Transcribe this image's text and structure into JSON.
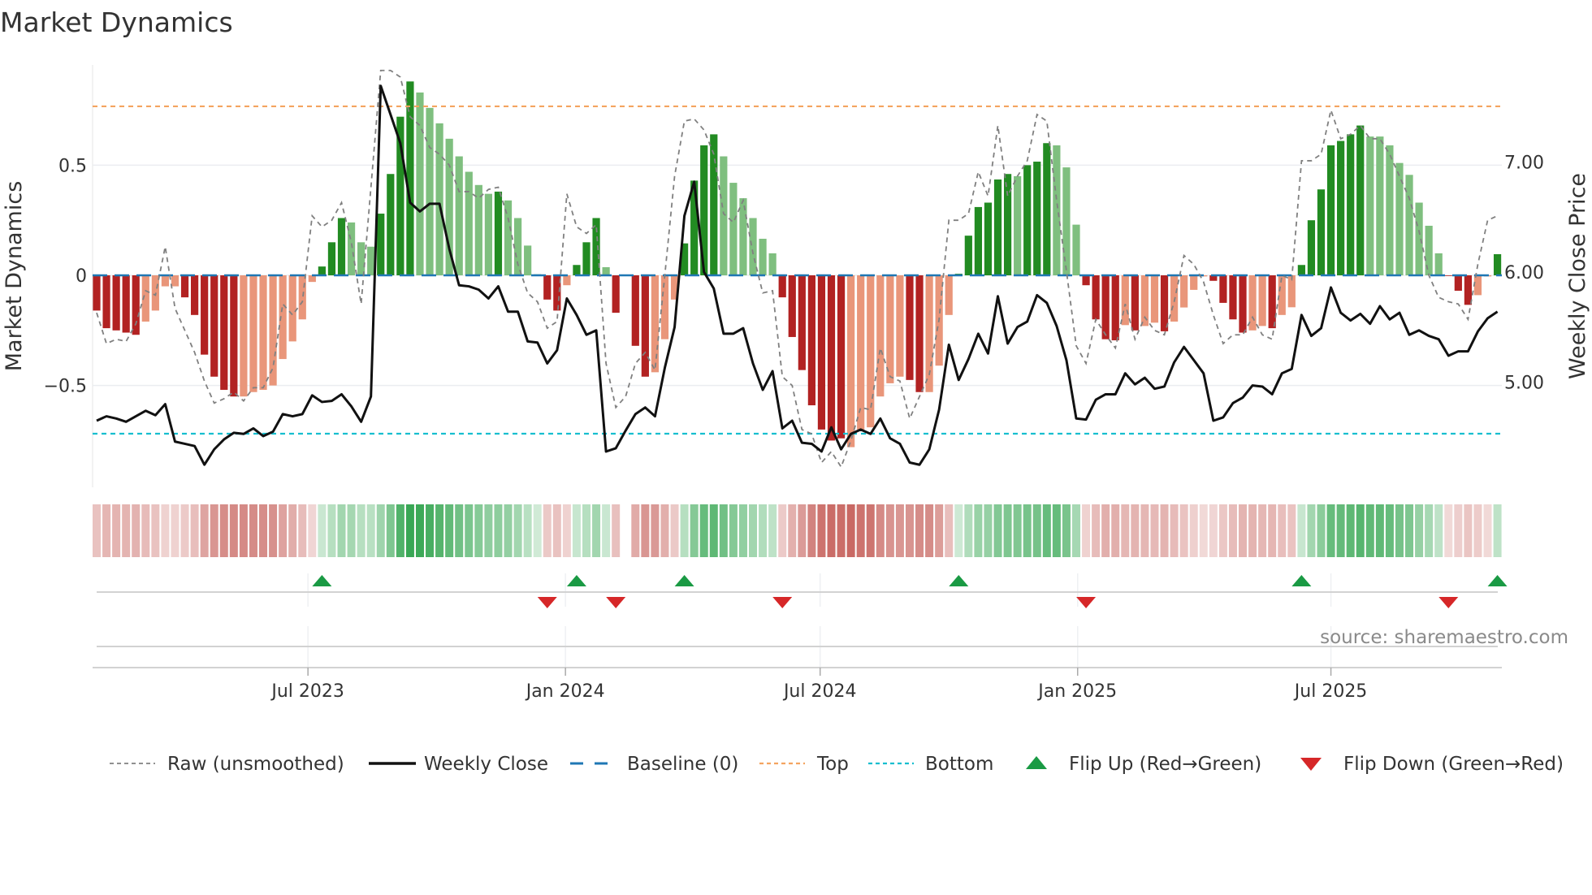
{
  "chart_data": {
    "type": "bar",
    "title": "Market Dynamics",
    "ylabel": "Market Dynamics",
    "y2label": "Weekly Close Price",
    "source": "source: sharemaestro.com",
    "start_date": "2023-01-31",
    "interval_days": 7,
    "ylim": [
      -0.97,
      0.95
    ],
    "y_ticks": [
      {
        "value": 0.5,
        "label": "0.5"
      },
      {
        "value": 0,
        "label": "0"
      },
      {
        "value": -0.5,
        "label": "−0.5"
      }
    ],
    "y2_ticks": [
      {
        "value": 7,
        "label": "7.00"
      },
      {
        "value": 6,
        "label": "6.00"
      },
      {
        "value": 5,
        "label": "5.00"
      }
    ],
    "x_ticks": [
      {
        "date": "2023-07-01",
        "label": "Jul 2023"
      },
      {
        "date": "2024-01-01",
        "label": "Jan 2024"
      },
      {
        "date": "2024-07-01",
        "label": "Jul 2024"
      },
      {
        "date": "2025-01-01",
        "label": "Jan 2025"
      },
      {
        "date": "2025-07-01",
        "label": "Jul 2025"
      }
    ],
    "top_level": 0.767,
    "bottom_level": -0.719,
    "baseline": 0,
    "colors": {
      "strong_up": "#228b22",
      "weak_up": "#7fbf7f",
      "strong_down": "#b22222",
      "weak_down": "#e9967a",
      "raw": "#808080",
      "close": "#111111",
      "baseline": "#1f77b4",
      "top": "#f4a460",
      "bottom": "#17becf",
      "flip_up": "#1a9a44",
      "flip_down": "#d62728",
      "strip_up": "#28a046",
      "strip_down": "#c0504a"
    },
    "dynamics": [
      -0.16,
      -0.24,
      -0.25,
      -0.26,
      -0.27,
      -0.21,
      -0.16,
      -0.05,
      -0.05,
      -0.1,
      -0.18,
      -0.36,
      -0.46,
      -0.52,
      -0.55,
      -0.55,
      -0.53,
      -0.52,
      -0.5,
      -0.38,
      -0.3,
      -0.2,
      -0.03,
      0.04,
      0.15,
      0.26,
      0.24,
      0.15,
      0.13,
      0.28,
      0.46,
      0.72,
      0.88,
      0.83,
      0.76,
      0.69,
      0.62,
      0.54,
      0.47,
      0.41,
      0.37,
      0.38,
      0.34,
      0.26,
      0.135,
      0.005,
      -0.11,
      -0.16,
      -0.045,
      0.047,
      0.15,
      0.26,
      0.037,
      -0.17,
      null,
      -0.32,
      -0.46,
      -0.44,
      -0.29,
      -0.11,
      0.145,
      0.43,
      0.59,
      0.64,
      0.54,
      0.42,
      0.35,
      0.26,
      0.166,
      0.1,
      -0.1,
      -0.28,
      -0.43,
      -0.59,
      -0.7,
      -0.75,
      -0.74,
      -0.78,
      -0.7,
      -0.69,
      -0.55,
      -0.49,
      -0.46,
      -0.475,
      -0.53,
      -0.53,
      -0.41,
      -0.18,
      0.007,
      0.18,
      0.31,
      0.33,
      0.435,
      0.46,
      0.45,
      0.5,
      0.516,
      0.6,
      0.59,
      0.49,
      0.23,
      -0.045,
      -0.2,
      -0.29,
      -0.295,
      -0.226,
      -0.25,
      -0.23,
      -0.215,
      -0.254,
      -0.21,
      -0.146,
      -0.066,
      -0.005,
      -0.025,
      -0.125,
      -0.2,
      -0.26,
      -0.25,
      -0.23,
      -0.24,
      -0.18,
      -0.145,
      0.047,
      0.25,
      0.39,
      0.59,
      0.61,
      0.64,
      0.68,
      0.63,
      0.63,
      0.59,
      0.51,
      0.456,
      0.33,
      0.225,
      0.1,
      -0.003,
      -0.07,
      -0.134,
      -0.09,
      -0.005,
      0.096
    ],
    "shade": "DDDDDLLLLDDDDDDLLLLLLLLDDDLLLDDDDLLLLLLLLDLLLLDDLDDDLD-DDLLLDDDDLLLLLLDDDDDDDLLLLLLDDLLLDDDDDDLDDDLLLDDDDLDLLDLLLLDDDDLLDLLDDDDDDDLLLLLLLLDDDLLD",
    "raw": [
      -0.17,
      -0.31,
      -0.29,
      -0.3,
      -0.22,
      -0.07,
      -0.09,
      0.13,
      -0.15,
      -0.25,
      -0.35,
      -0.48,
      -0.58,
      -0.56,
      -0.53,
      -0.57,
      -0.51,
      -0.51,
      -0.42,
      -0.13,
      -0.18,
      -0.12,
      0.27,
      0.22,
      0.25,
      0.33,
      0.15,
      -0.13,
      0.4,
      0.93,
      0.93,
      0.9,
      0.72,
      0.68,
      0.58,
      0.55,
      0.5,
      0.38,
      0.38,
      0.35,
      0.39,
      0.4,
      0.26,
      0.05,
      -0.08,
      -0.12,
      -0.24,
      -0.21,
      0.37,
      0.22,
      0.19,
      0.23,
      -0.4,
      -0.6,
      -0.55,
      -0.4,
      -0.35,
      -0.43,
      0.0,
      0.45,
      0.7,
      0.71,
      0.66,
      0.55,
      0.28,
      0.24,
      0.34,
      0.1,
      -0.08,
      -0.07,
      -0.46,
      -0.5,
      -0.7,
      -0.72,
      -0.85,
      -0.8,
      -0.87,
      -0.75,
      -0.6,
      -0.61,
      -0.33,
      -0.46,
      -0.48,
      -0.65,
      -0.55,
      -0.45,
      -0.2,
      0.25,
      0.25,
      0.28,
      0.47,
      0.36,
      0.68,
      0.36,
      0.45,
      0.52,
      0.73,
      0.7,
      0.34,
      0.02,
      -0.32,
      -0.4,
      -0.2,
      -0.27,
      -0.33,
      -0.13,
      -0.29,
      -0.19,
      -0.25,
      -0.27,
      -0.12,
      0.09,
      0.05,
      -0.03,
      -0.18,
      -0.31,
      -0.27,
      -0.27,
      -0.19,
      -0.27,
      -0.29,
      0.0,
      -0.02,
      0.52,
      0.52,
      0.55,
      0.75,
      0.62,
      0.64,
      0.68,
      0.62,
      0.62,
      0.55,
      0.45,
      0.35,
      0.2,
      0.0,
      -0.1,
      -0.12,
      -0.13,
      -0.2,
      0.05,
      0.25,
      0.27
    ],
    "close": [
      4.68,
      4.72,
      4.7,
      4.67,
      4.72,
      4.77,
      4.73,
      4.83,
      4.49,
      4.47,
      4.45,
      4.28,
      4.42,
      4.51,
      4.57,
      4.56,
      4.61,
      4.54,
      4.58,
      4.74,
      4.72,
      4.74,
      4.91,
      4.85,
      4.86,
      4.92,
      4.81,
      4.67,
      4.9,
      7.72,
      7.46,
      7.2,
      6.66,
      6.58,
      6.65,
      6.65,
      6.24,
      5.91,
      5.9,
      5.87,
      5.79,
      5.9,
      5.67,
      5.67,
      5.4,
      5.39,
      5.2,
      5.32,
      5.79,
      5.64,
      5.46,
      5.5,
      4.4,
      4.43,
      4.59,
      4.74,
      4.8,
      4.72,
      5.16,
      5.53,
      6.54,
      6.85,
      6.03,
      5.88,
      5.47,
      5.47,
      5.52,
      5.2,
      4.96,
      5.13,
      4.61,
      4.68,
      4.48,
      4.47,
      4.4,
      4.62,
      4.42,
      4.56,
      4.6,
      4.56,
      4.7,
      4.52,
      4.47,
      4.3,
      4.28,
      4.42,
      4.78,
      5.37,
      5.05,
      5.24,
      5.47,
      5.29,
      5.81,
      5.38,
      5.53,
      5.58,
      5.82,
      5.75,
      5.54,
      5.23,
      4.7,
      4.69,
      4.87,
      4.92,
      4.92,
      5.11,
      5.01,
      5.07,
      4.97,
      4.99,
      5.21,
      5.35,
      5.23,
      5.11,
      4.68,
      4.71,
      4.84,
      4.89,
      5.0,
      4.99,
      4.92,
      5.11,
      5.15,
      5.64,
      5.45,
      5.52,
      5.89,
      5.66,
      5.59,
      5.65,
      5.56,
      5.72,
      5.6,
      5.66,
      5.46,
      5.5,
      5.45,
      5.42,
      5.27,
      5.31,
      5.31,
      5.49,
      5.61,
      5.67
    ],
    "flip_up_weeks": [
      24,
      50,
      61,
      89,
      124,
      144
    ],
    "flip_down_weeks": [
      47,
      54,
      71,
      102,
      139
    ],
    "legend": {
      "placement": "bottom",
      "items": [
        {
          "key": "raw",
          "label": "Raw (unsmoothed)"
        },
        {
          "key": "close",
          "label": "Weekly Close"
        },
        {
          "key": "baseline",
          "label": "Baseline (0)"
        },
        {
          "key": "top",
          "label": "Top"
        },
        {
          "key": "bottom",
          "label": "Bottom"
        },
        {
          "key": "flip_up",
          "label": "Flip Up (Red→Green)"
        },
        {
          "key": "flip_down",
          "label": "Flip Down (Green→Red)"
        }
      ]
    }
  }
}
